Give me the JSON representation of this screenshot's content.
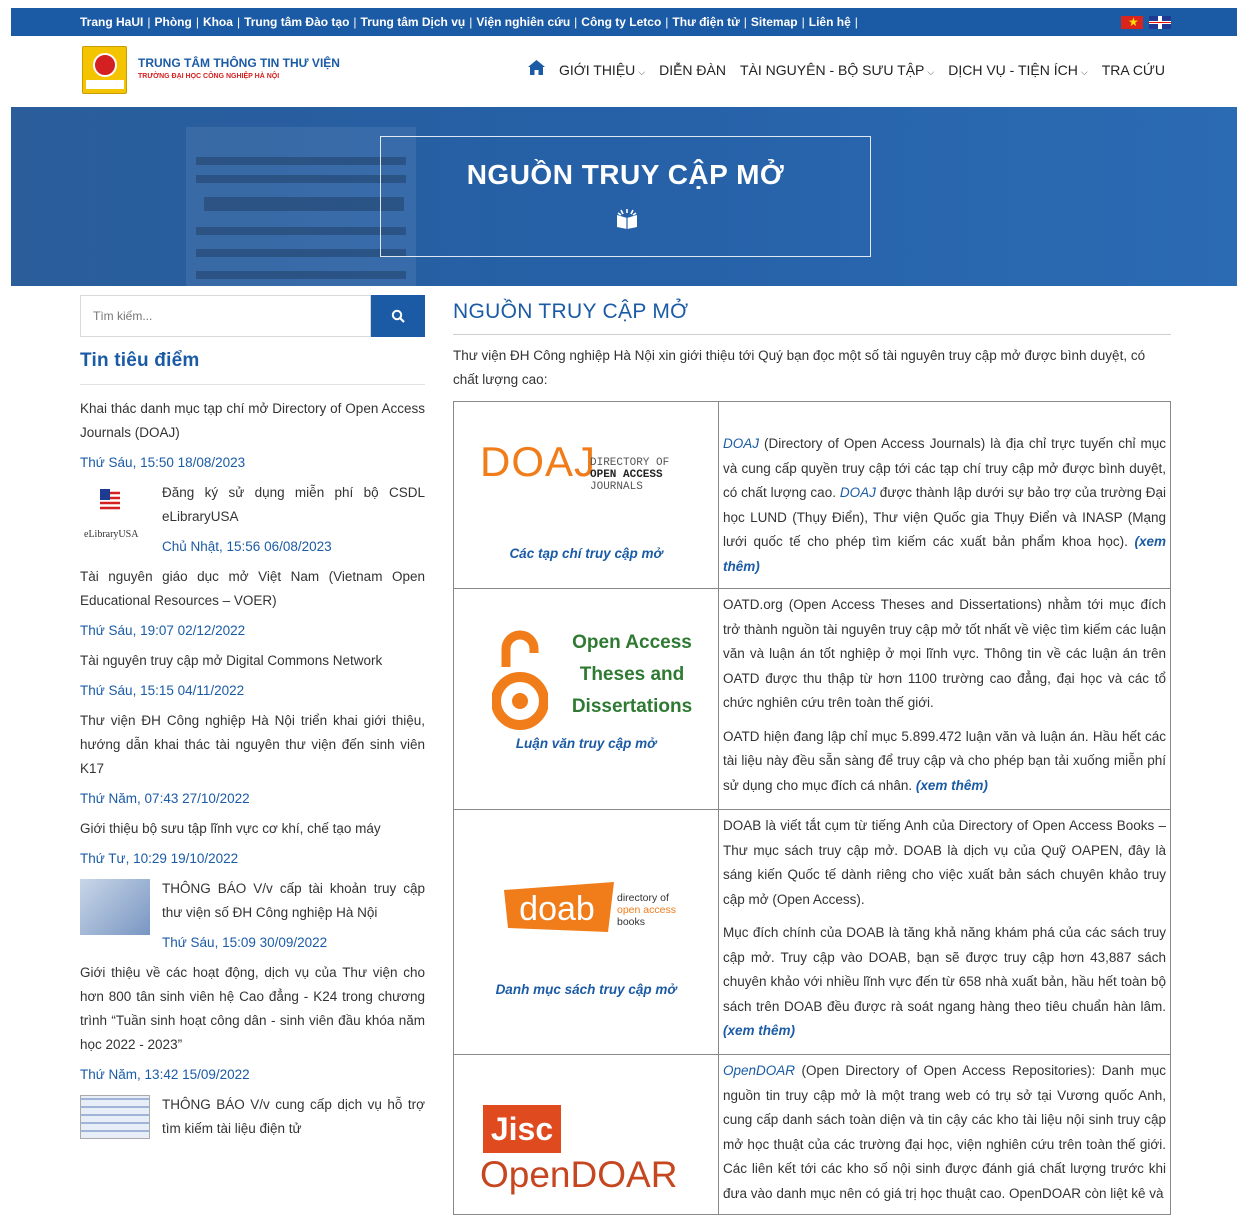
{
  "topbar": {
    "links": [
      "Trang HaUI",
      "Phòng",
      "Khoa",
      "Trung tâm Đào tạo",
      "Trung tâm Dịch vụ",
      "Viện nghiên cứu",
      "Công ty Letco",
      "Thư điện tử",
      "Sitemap",
      "Liên hệ"
    ],
    "languages": [
      "vi",
      "en"
    ]
  },
  "header": {
    "logo_title": "TRUNG TÂM THÔNG TIN THƯ VIỆN",
    "logo_subtitle": "TRƯỜNG ĐẠI HỌC CÔNG NGHIỆP HÀ NỘI",
    "nav": [
      {
        "label": "GIỚI THIỆU",
        "dropdown": true
      },
      {
        "label": "DIỄN ĐÀN",
        "dropdown": false
      },
      {
        "label": "TÀI NGUYÊN - BỘ SƯU TẬP",
        "dropdown": true
      },
      {
        "label": "DỊCH VỤ - TIỆN ÍCH",
        "dropdown": true
      },
      {
        "label": "TRA CỨU",
        "dropdown": false
      }
    ]
  },
  "banner": {
    "title": "NGUỒN TRUY CẬP MỞ"
  },
  "search": {
    "placeholder": "Tìm kiếm..."
  },
  "sidebar": {
    "heading": "Tin tiêu điểm",
    "news": [
      {
        "title": "Khai thác danh mục tạp chí mở Directory of Open Access Journals (DOAJ)",
        "date": "Thứ Sáu, 15:50 18/08/2023"
      },
      {
        "title": "Đăng ký sử dụng miễn phí bộ CSDL eLibraryUSA",
        "date": "Chủ Nhật, 15:56 06/08/2023",
        "thumb_caption": "eLibraryUSA"
      },
      {
        "title": "Tài nguyên giáo dục mở Việt Nam (Vietnam Open Educational Resources – VOER)",
        "date": "Thứ Sáu, 19:07 02/12/2022"
      },
      {
        "title": "Tài nguyên truy cập mở Digital Commons Network",
        "date": "Thứ Sáu, 15:15 04/11/2022"
      },
      {
        "title": "Thư viện ĐH Công nghiệp Hà Nội triển khai giới thiệu, hướng dẫn khai thác tài nguyên thư viện đến sinh viên K17",
        "date": "Thứ Năm, 07:43 27/10/2022"
      },
      {
        "title": "Giới thiệu bộ sưu tập lĩnh vực cơ khí, chế tạo máy",
        "date": "Thứ Tư, 10:29 19/10/2022"
      },
      {
        "title": "THÔNG BÁO V/v cấp tài khoản truy cập thư viện số ĐH Công nghiệp Hà Nội",
        "date": "Thứ Sáu, 15:09 30/09/2022"
      },
      {
        "title": "Giới thiệu về các hoạt động, dịch vụ của Thư viện cho hơn 800 tân sinh viên hệ Cao đẳng - K24 trong chương trình “Tuần sinh hoạt công dân - sinh viên đầu khóa năm học 2022 - 2023”",
        "date": "Thứ Năm, 13:42 15/09/2022"
      },
      {
        "title": "THÔNG BÁO V/v cung cấp dịch vụ hỗ trợ tìm kiếm tài liệu điện tử"
      }
    ]
  },
  "main": {
    "title": "NGUỒN TRUY CẬP MỞ",
    "intro": "Thư viện ĐH Công nghiệp Hà Nội xin giới thiệu tới Quý bạn đọc một số tài nguyên truy cập mở được bình duyệt, có chất lượng cao:",
    "resources": [
      {
        "logo_text": "DOAJ",
        "logo_small": [
          "DIRECTORY OF",
          "OPEN ACCESS",
          "JOURNALS"
        ],
        "caption": "Các tạp chí truy cập mở",
        "p1_name": "DOAJ",
        "p1_a": " (Directory of Open Access Journals) là địa chỉ trực tuyến chỉ mục và cung cấp quyền truy cập tới các tạp chí truy cập mở được bình duyệt, có chất lượng cao. ",
        "p1_name2": "DOAJ",
        "p1_b": " được thành lập dưới sự bảo trợ của trường Đại học LUND (Thụy Điển), Thư viện Quốc gia Thụy Điển và INASP (Mạng lưới quốc tế cho phép tìm kiếm các xuất bản phẩm khoa học). ",
        "more": "(xem thêm)"
      },
      {
        "logo_lines": [
          "Open Access",
          "Theses and",
          "Dissertations"
        ],
        "caption": "Luận văn truy cập mở",
        "p1": "OATD.org (Open Access Theses and Dissertations) nhằm tới mục đích trở thành nguồn tài nguyên truy cập mở tốt nhất về việc tìm kiếm các luận văn và luận án tốt nghiệp ở mọi lĩnh vực. Thông tin về các luận án trên OATD được thu thập từ hơn 1100 trường cao đẳng, đại học và các tổ chức nghiên cứu trên toàn thế giới.",
        "p2": "OATD hiện đang lập chỉ mục 5.899.472 luận văn và luận án. Hầu hết các tài liệu này đều sẵn sàng để truy cập và cho phép bạn tải xuống miễn phí sử dụng cho mục đích cá nhân. ",
        "more": "(xem thêm)"
      },
      {
        "logo_text": "doab",
        "logo_small": [
          "directory of",
          "open access",
          "books"
        ],
        "caption": "Danh mục sách truy cập mở",
        "p1": "DOAB là viết tắt cụm từ tiếng Anh của Directory of Open Access Books – Thư mục sách truy cập mở. DOAB là dịch vụ của Quỹ OAPEN, đây là sáng kiến Quốc tế dành riêng cho việc xuất bản sách chuyên khảo truy cập mở (Open Access).",
        "p2": "Mục đích chính của DOAB là tăng khả năng khám phá của các sách truy cập mở. Truy cập vào DOAB, bạn sẽ được truy cập hơn 43,887 sách chuyên khảo với nhiều lĩnh vực đến từ 658 nhà xuất bản, hầu hết toàn bộ sách trên DOAB đều được rà soát ngang hàng theo tiêu chuẩn hàn lâm.",
        "more": "(xem thêm)"
      },
      {
        "logo_text": "Jisc",
        "logo_text2": "OpenDOAR",
        "p1_name": "OpenDOAR",
        "p1_a": " (Open Directory of Open Access Repositories): Danh mục nguồn tin truy cập mở là một trang web có trụ sở tại Vương quốc Anh, cung cấp danh sách toàn diện và tin cậy các kho tài liệu nội sinh truy cập mở học thuật của các trường đại học, viện nghiên cứu trên toàn thế giới. Các liên kết tới các kho số nội sinh được đánh giá chất lượng trước khi đưa vào danh mục nên có giá trị học thuật cao. OpenDOAR còn liệt kê và"
      }
    ]
  }
}
